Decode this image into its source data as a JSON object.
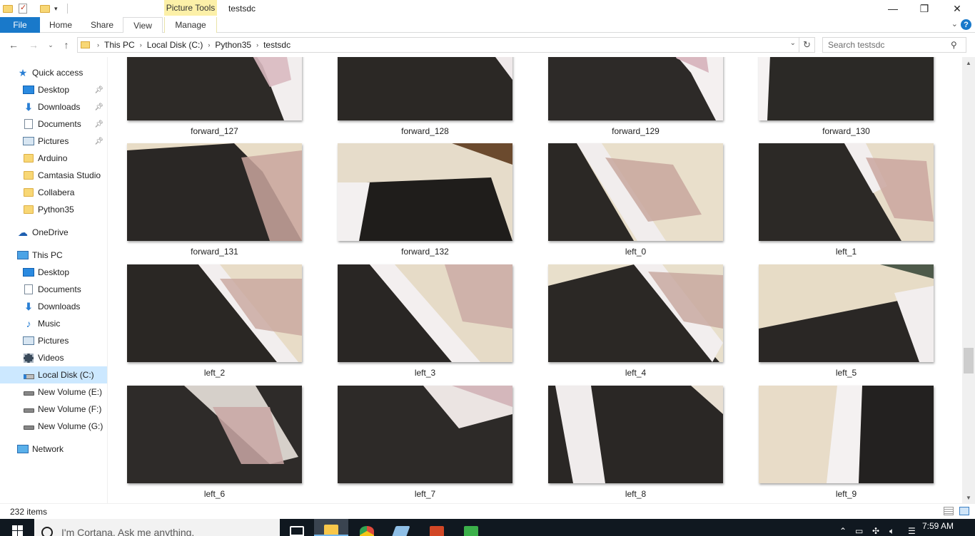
{
  "window": {
    "title": "testsdc",
    "context_tab_group": "Picture Tools",
    "minimize_glyph": "—",
    "maximize_glyph": "❐",
    "close_glyph": "✕"
  },
  "ribbon": {
    "tabs": [
      {
        "label": "File",
        "active": false
      },
      {
        "label": "Home",
        "active": false
      },
      {
        "label": "Share",
        "active": false
      },
      {
        "label": "View",
        "active": true
      },
      {
        "label": "Manage",
        "active": false
      }
    ],
    "help_label": "?",
    "accent_color": "#1979ca",
    "context_color": "#fcf0a8"
  },
  "address": {
    "breadcrumbs": [
      "This PC",
      "Local Disk (C:)",
      "Python35",
      "testsdc"
    ],
    "search_placeholder": "Search testsdc"
  },
  "sidebar": {
    "quick_access": "Quick access",
    "items": [
      {
        "label": "Quick access",
        "icon": "star-icon",
        "pinned": false,
        "indent": 1
      },
      {
        "label": "Desktop",
        "icon": "desktop-icon",
        "pinned": true,
        "indent": 2
      },
      {
        "label": "Downloads",
        "icon": "download-icon",
        "pinned": true,
        "indent": 2
      },
      {
        "label": "Documents",
        "icon": "document-icon",
        "pinned": true,
        "indent": 2
      },
      {
        "label": "Pictures",
        "icon": "pictures-icon",
        "pinned": true,
        "indent": 2
      },
      {
        "label": "Arduino",
        "icon": "folder-icon",
        "pinned": false,
        "indent": 2
      },
      {
        "label": "Camtasia Studio",
        "icon": "folder-icon",
        "pinned": false,
        "indent": 2
      },
      {
        "label": "Collabera",
        "icon": "folder-icon",
        "pinned": false,
        "indent": 2
      },
      {
        "label": "Python35",
        "icon": "folder-icon",
        "pinned": false,
        "indent": 2
      },
      {
        "label": "OneDrive",
        "icon": "onedrive-icon",
        "pinned": false,
        "indent": 1
      },
      {
        "label": "This PC",
        "icon": "this-pc-icon",
        "pinned": false,
        "indent": 1
      },
      {
        "label": "Desktop",
        "icon": "desktop-icon",
        "pinned": false,
        "indent": 2
      },
      {
        "label": "Documents",
        "icon": "document-icon",
        "pinned": false,
        "indent": 2
      },
      {
        "label": "Downloads",
        "icon": "download-icon",
        "pinned": false,
        "indent": 2
      },
      {
        "label": "Music",
        "icon": "music-icon",
        "pinned": false,
        "indent": 2
      },
      {
        "label": "Pictures",
        "icon": "pictures-icon",
        "pinned": false,
        "indent": 2
      },
      {
        "label": "Videos",
        "icon": "videos-icon",
        "pinned": false,
        "indent": 2
      },
      {
        "label": "Local Disk (C:)",
        "icon": "local-disk-icon",
        "pinned": false,
        "indent": 2,
        "selected": true
      },
      {
        "label": "New Volume (E:)",
        "icon": "drive-icon",
        "pinned": false,
        "indent": 2
      },
      {
        "label": "New Volume (F:)",
        "icon": "drive-icon",
        "pinned": false,
        "indent": 2
      },
      {
        "label": "New Volume (G:)",
        "icon": "drive-icon",
        "pinned": false,
        "indent": 2
      },
      {
        "label": "Network",
        "icon": "network-icon",
        "pinned": false,
        "indent": 1
      }
    ]
  },
  "files": [
    {
      "name": "forward_127"
    },
    {
      "name": "forward_128"
    },
    {
      "name": "forward_129"
    },
    {
      "name": "forward_130"
    },
    {
      "name": "forward_131"
    },
    {
      "name": "forward_132"
    },
    {
      "name": "left_0"
    },
    {
      "name": "left_1"
    },
    {
      "name": "left_2"
    },
    {
      "name": "left_3"
    },
    {
      "name": "left_4"
    },
    {
      "name": "left_5"
    },
    {
      "name": "left_6"
    },
    {
      "name": "left_7"
    },
    {
      "name": "left_8"
    },
    {
      "name": "left_9"
    }
  ],
  "status": {
    "item_count": "232 items"
  },
  "taskbar": {
    "cortana_placeholder": "I'm Cortana. Ask me anything.",
    "time": "7:59 AM",
    "apps": [
      {
        "name": "task-view",
        "color": "#ffffff"
      },
      {
        "name": "file-explorer",
        "color": "#f8c74a"
      },
      {
        "name": "chrome",
        "color": "#e04a3c"
      },
      {
        "name": "unknown-app",
        "color": "#8fbfe6"
      },
      {
        "name": "powerpoint",
        "color": "#d24726"
      },
      {
        "name": "camtasia",
        "color": "#3bb04a"
      }
    ]
  }
}
